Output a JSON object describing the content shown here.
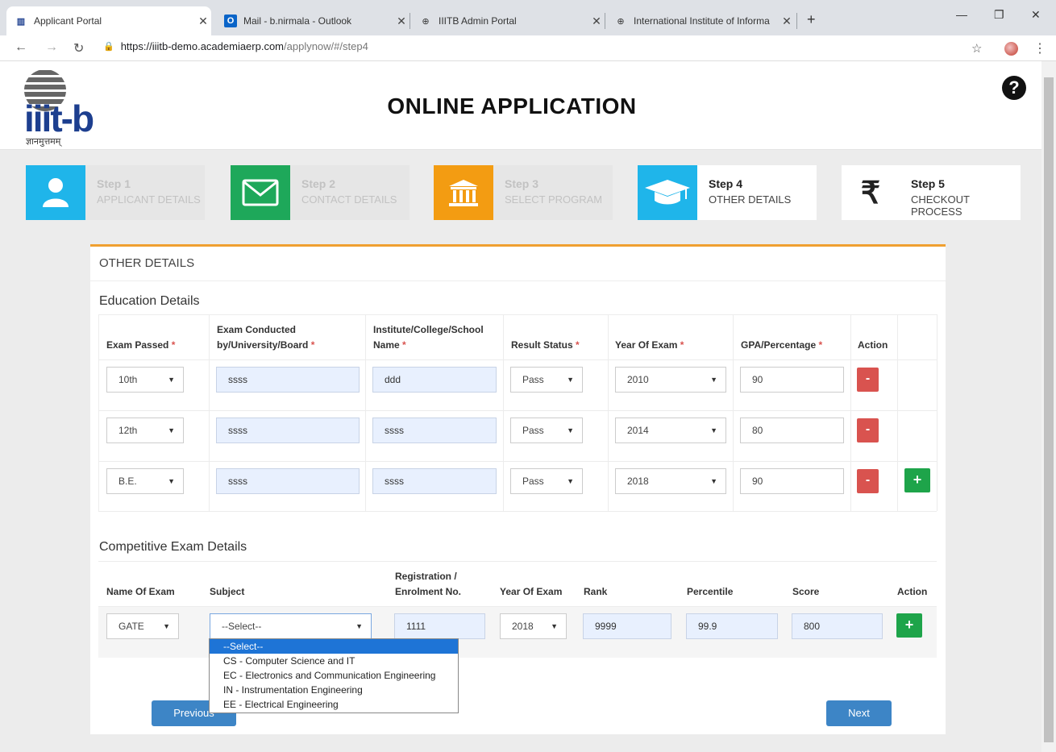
{
  "browser": {
    "tabs": [
      {
        "title": "Applicant Portal",
        "icon": "iiitb-favicon"
      },
      {
        "title": "Mail - b.nirmala - Outlook",
        "icon": "outlook-icon"
      },
      {
        "title": "IIITB Admin Portal",
        "icon": "globe-icon"
      },
      {
        "title": "International Institute of Informa",
        "icon": "globe-icon"
      }
    ],
    "url_host": "https://iiitb-demo.academiaerp.com",
    "url_path": "/applynow/#/step4"
  },
  "header": {
    "brand": "iiit-b",
    "tagline": "ज्ञानमुत्तमम्",
    "title": "ONLINE APPLICATION"
  },
  "steps": [
    {
      "num": "Step 1",
      "label": "APPLICANT DETAILS",
      "color": "#1fb5ea",
      "icon": "user-icon"
    },
    {
      "num": "Step 2",
      "label": "CONTACT DETAILS",
      "color": "#1ea85a",
      "icon": "envelope-icon"
    },
    {
      "num": "Step 3",
      "label": "SELECT PROGRAM",
      "color": "#f39c12",
      "icon": "institution-icon"
    },
    {
      "num": "Step 4",
      "label": "OTHER DETAILS",
      "color": "#1fb5ea",
      "icon": "graduation-cap-icon"
    },
    {
      "num": "Step 5",
      "label": "CHECKOUT PROCESS",
      "color": "#ffffff",
      "icon": "rupee-icon"
    }
  ],
  "card": {
    "title": "OTHER DETAILS",
    "education_title": "Education Details",
    "competitive_title": "Competitive Exam Details"
  },
  "education": {
    "headers": {
      "exam_passed": "Exam Passed",
      "conducted_1": "Exam Conducted",
      "conducted_2": "by/University/Board",
      "institute_1": "Institute/College/School",
      "institute_2": "Name",
      "result": "Result Status",
      "year": "Year Of Exam",
      "gpa": "GPA/Percentage",
      "action": "Action"
    },
    "rows": [
      {
        "exam": "10th",
        "board": "ssss",
        "institute": "ddd",
        "result": "Pass",
        "year": "2010",
        "gpa": "90"
      },
      {
        "exam": "12th",
        "board": "ssss",
        "institute": "ssss",
        "result": "Pass",
        "year": "2014",
        "gpa": "80"
      },
      {
        "exam": "B.E.",
        "board": "ssss",
        "institute": "ssss",
        "result": "Pass",
        "year": "2018",
        "gpa": "90"
      }
    ],
    "remove_label": "-",
    "add_label": "+"
  },
  "competitive": {
    "headers": {
      "name": "Name Of Exam",
      "subject": "Subject",
      "reg_1": "Registration /",
      "reg_2": "Enrolment No.",
      "year": "Year Of Exam",
      "rank": "Rank",
      "percentile": "Percentile",
      "score": "Score",
      "action": "Action"
    },
    "row": {
      "exam": "GATE",
      "subject": "--Select--",
      "registration": "1111",
      "year": "2018",
      "rank": "9999",
      "percentile": "99.9",
      "score": "800"
    },
    "add_label": "+",
    "subject_options": [
      "--Select--",
      "CS - Computer Science and IT",
      "EC - Electronics and Communication Engineering",
      "IN - Instrumentation Engineering",
      "EE - Electrical Engineering"
    ]
  },
  "footer": {
    "previous": "Previous",
    "next": "Next"
  },
  "colors": {
    "accent_orange": "#f0a030",
    "remove_red": "#d9534f",
    "add_green": "#1ea44a",
    "primary_blue": "#3d85c6"
  }
}
